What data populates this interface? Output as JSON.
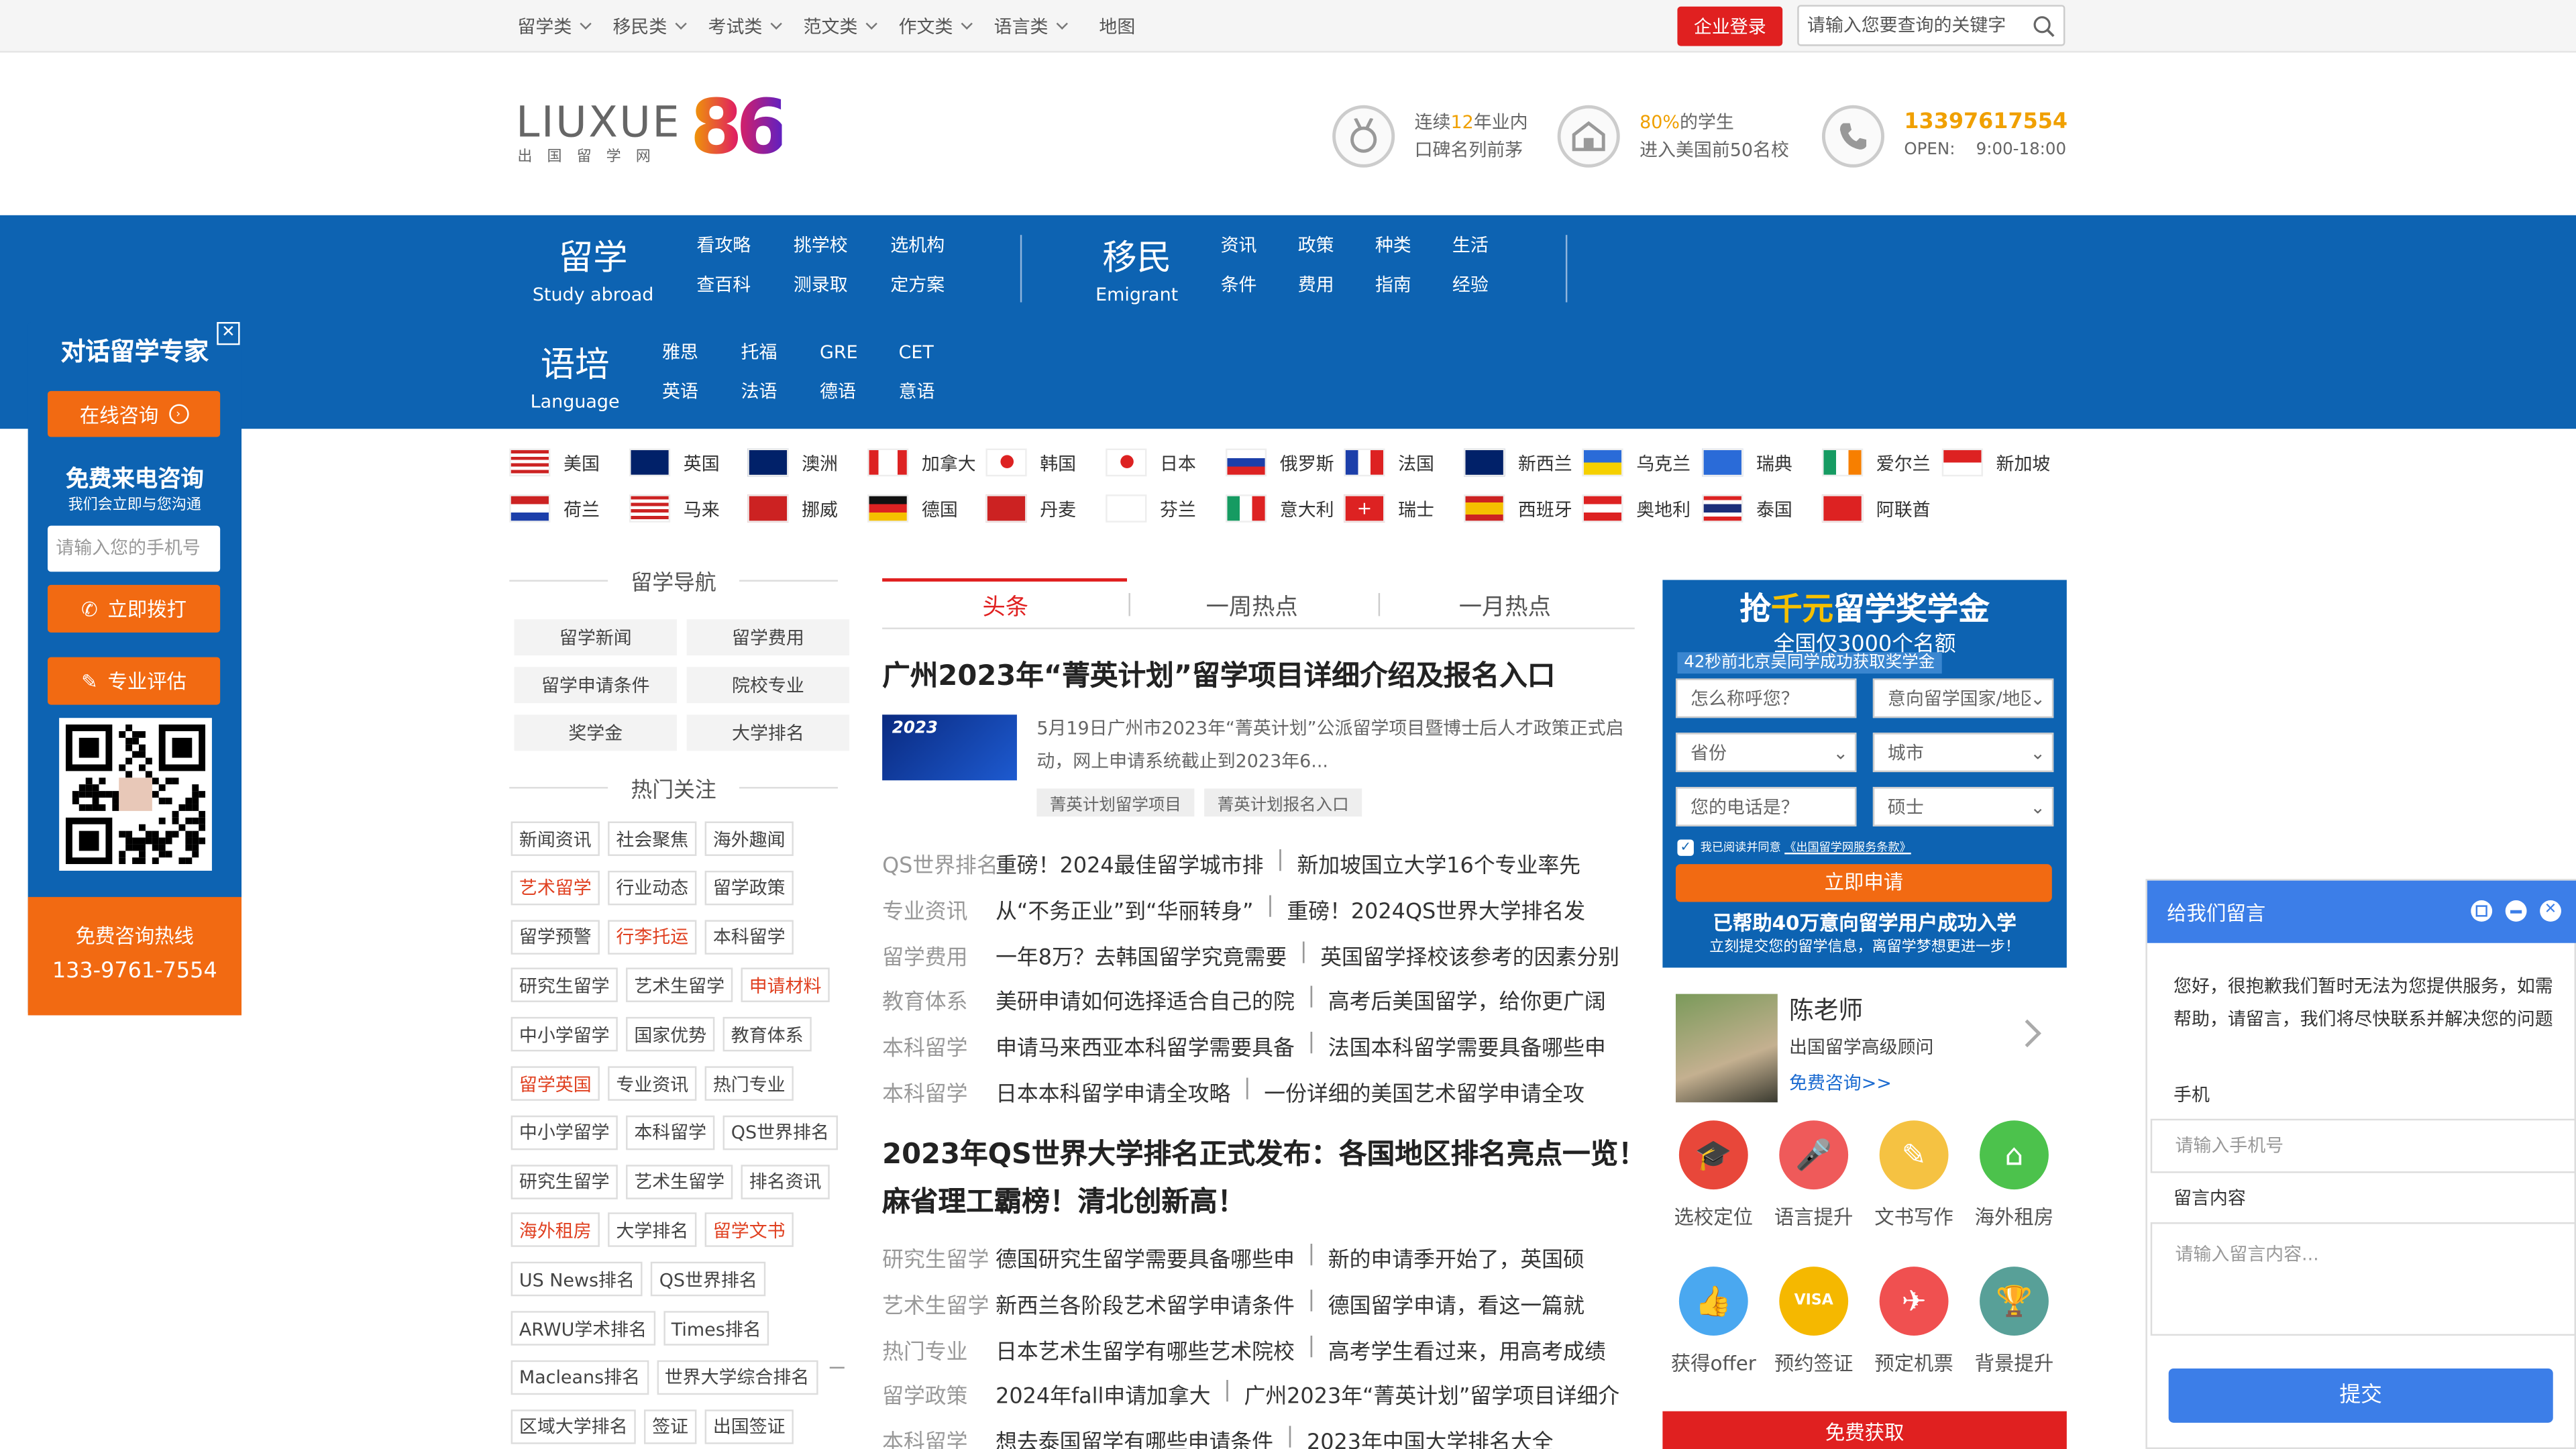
{
  "topbar": {
    "menus": [
      "留学类",
      "移民类",
      "考试类",
      "范文类",
      "作文类",
      "语言类"
    ],
    "map": "地图",
    "login": "企业登录",
    "search_placeholder": "请输入您要查询的关键字"
  },
  "header": {
    "logo_text": "LIUXUE",
    "logo_num": "86",
    "logo_sub": "出国留学网",
    "feat1": {
      "pre": "连续",
      "hl": "12",
      "post": "年业内",
      "line2": "口碑名列前茅"
    },
    "feat2": {
      "hl": "80%",
      "post": "的学生",
      "line2": "进入美国前50名校"
    },
    "feat3": {
      "phone": "13397617554",
      "open": "OPEN:",
      "hours": "9:00-18:00"
    }
  },
  "nav": {
    "study": {
      "title": "留学",
      "en": "Study abroad",
      "links": [
        "看攻略",
        "挑学校",
        "选机构",
        "查百科",
        "测录取",
        "定方案"
      ]
    },
    "emigrant": {
      "title": "移民",
      "en": "Emigrant",
      "links": [
        "资讯",
        "政策",
        "种类",
        "生活",
        "条件",
        "费用",
        "指南",
        "经验"
      ]
    },
    "language": {
      "title": "语培",
      "en": "Language",
      "links": [
        "雅思",
        "托福",
        "GRE",
        "CET",
        "英语",
        "法语",
        "德语",
        "意语"
      ]
    }
  },
  "countries": [
    "美国",
    "英国",
    "澳洲",
    "加拿大",
    "韩国",
    "日本",
    "俄罗斯",
    "法国",
    "新西兰",
    "乌克兰",
    "瑞典",
    "爱尔兰",
    "新加坡",
    "荷兰",
    "马来",
    "挪威",
    "德国",
    "丹麦",
    "芬兰",
    "意大利",
    "瑞士",
    "西班牙",
    "奥地利",
    "泰国",
    "阿联酋"
  ],
  "left": {
    "nav_title": "留学导航",
    "nav_items": [
      "留学新闻",
      "留学费用",
      "留学申请条件",
      "院校专业",
      "奖学金",
      "大学排名"
    ],
    "hot_title": "热门关注",
    "tags": [
      [
        "新闻资讯",
        "社会聚焦",
        "海外趣闻"
      ],
      [
        "艺术留学",
        "行业动态",
        "留学政策"
      ],
      [
        "留学预警",
        "行李托运",
        "本科留学"
      ],
      [
        "研究生留学",
        "艺术生留学",
        "申请材料"
      ],
      [
        "中小学留学",
        "国家优势",
        "教育体系"
      ],
      [
        "留学英国",
        "专业资讯",
        "热门专业"
      ],
      [
        "中小学留学",
        "本科留学",
        "QS世界排名"
      ],
      [
        "研究生留学",
        "艺术生留学",
        "排名资讯"
      ],
      [
        "海外租房",
        "大学排名",
        "留学文书"
      ],
      [
        "US News排名",
        "QS世界排名"
      ],
      [
        "ARWU学术排名",
        "Times排名"
      ],
      [
        "Macleans排名",
        "世界大学综合排名"
      ],
      [
        "区域大学排名",
        "签证",
        "出国签证"
      ]
    ]
  },
  "center": {
    "tabs": [
      "头条",
      "一周热点",
      "一月热点"
    ],
    "headline1": "广州2023年“菁英计划”留学项目详细介绍及报名入口",
    "thumb_text": "2023",
    "summary": "5月19日广州市2023年“菁英计划”公派留学项目暨博士后人才政策正式启动，网上申请系统截止到2023年6...",
    "pills": [
      "菁英计划留学项目",
      "菁英计划报名入口"
    ],
    "list1": [
      {
        "cat": "QS世界排名",
        "a": "重磅！2024最佳留学城市排",
        "b": "新加坡国立大学16个专业率先"
      },
      {
        "cat": "专业资讯",
        "a": "从“不务正业”到“华丽转身”",
        "b": "重磅！2024QS世界大学排名发"
      },
      {
        "cat": "留学费用",
        "a": "一年8万？去韩国留学究竟需要",
        "b": "英国留学择校该参考的因素分别"
      },
      {
        "cat": "教育体系",
        "a": "美研申请如何选择适合自己的院",
        "b": "高考后美国留学，给你更广阔"
      },
      {
        "cat": "本科留学",
        "a": "申请马来西亚本科留学需要具备",
        "b": "法国本科留学需要具备哪些申"
      },
      {
        "cat": "本科留学",
        "a": "日本本科留学申请全攻略",
        "b": "一份详细的美国艺术留学申请全攻"
      }
    ],
    "headline2a": "2023年QS世界大学排名正式发布：各国地区排名亮点一览！",
    "headline2b": "麻省理工霸榜！清北创新高！",
    "list2": [
      {
        "cat": "研究生留学",
        "a": "德国研究生留学需要具备哪些申",
        "b": "新的申请季开始了，英国硕"
      },
      {
        "cat": "艺术生留学",
        "a": "新西兰各阶段艺术留学申请条件",
        "b": "德国留学申请，看这一篇就"
      },
      {
        "cat": "热门专业",
        "a": "日本艺术生留学有哪些艺术院校",
        "b": "高考学生看过来，用高考成绩"
      },
      {
        "cat": "留学政策",
        "a": "2024年fall申请加拿大",
        "b": "广州2023年“菁英计划”留学项目详细介"
      },
      {
        "cat": "本科留学",
        "a": "想去泰国留学有哪些申请条件",
        "b": "2023年中国大学排名大全"
      }
    ]
  },
  "promo": {
    "title_pre": "抢",
    "title_hl": "千元",
    "title_post": "留学奖学金",
    "sub": "全国仅3000个名额",
    "ticker": "42秒前北京吴同学成功获取奖学金",
    "name_ph": "怎么称呼您？",
    "country_ph": "意向留学国家/地区",
    "province": "省份",
    "city": "城市",
    "phone_ph": "您的电话是？",
    "degree": "硕士",
    "agree": "我已阅读并同意",
    "agree_link": "《出国留学网服务条款》",
    "apply": "立即申请",
    "helped": "已帮助40万意向留学用户成功入学",
    "helped_sub": "立刻提交您的留学信息，离留学梦想更进一步！"
  },
  "advisor": {
    "name": "陈老师",
    "title": "出国留学高级顾问",
    "consult": "免费咨询>>"
  },
  "services": [
    {
      "label": "选校定位",
      "color": "#e8473a",
      "icon": "🎓"
    },
    {
      "label": "语言提升",
      "color": "#ef5a5a",
      "icon": "🎤"
    },
    {
      "label": "文书写作",
      "color": "#f5c242",
      "icon": "✎"
    },
    {
      "label": "海外租房",
      "color": "#4cc24c",
      "icon": "⌂"
    },
    {
      "label": "获得offer",
      "color": "#4aa8f0",
      "icon": "👍"
    },
    {
      "label": "预约签证",
      "color": "#f5b800",
      "icon": "VISA"
    },
    {
      "label": "预定机票",
      "color": "#f05050",
      "icon": "✈"
    },
    {
      "label": "背景提升",
      "color": "#58a098",
      "icon": "🏆"
    }
  ],
  "free_get": "免费获取",
  "leftchat": {
    "title": "对话留学专家",
    "online": "在线咨询",
    "callback": "免费来电咨询",
    "callback_sub": "我们会立即与您沟通",
    "phone_ph": "请输入您的手机号",
    "dial": "立即拨打",
    "eval": "专业评估",
    "hotline_label": "免费咨询热线",
    "hotline": "133-9761-7554"
  },
  "msgpanel": {
    "title": "给我们留言",
    "notice": "您好，很抱歉我们暂时无法为您提供服务，如需帮助，请留言，我们将尽快联系并解决您的问题",
    "phone_label": "手机",
    "phone_ph": "请输入手机号",
    "msg_label": "留言内容",
    "msg_ph": "请输入留言内容...",
    "submit": "提交"
  }
}
